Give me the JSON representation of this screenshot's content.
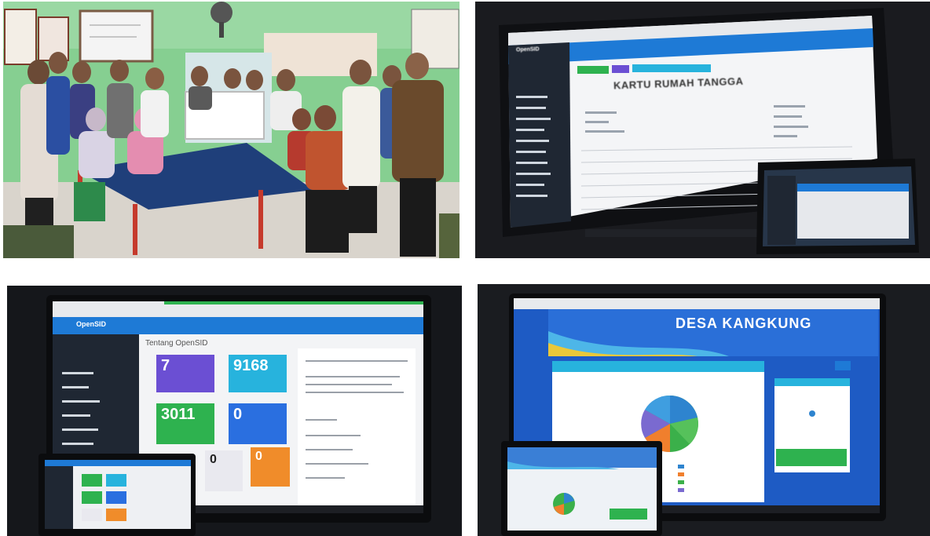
{
  "photo_top_right": {
    "app_name": "OpenSID",
    "heading": "KARTU RUMAH TANGGA"
  },
  "photo_bottom_left": {
    "app_name": "OpenSID",
    "page_title": "Tentang OpenSID",
    "tiles": [
      {
        "value": "7",
        "color": "#6b4fd3"
      },
      {
        "value": "9168",
        "color": "#27b3dd"
      },
      {
        "value": "3011",
        "color": "#2eb24f"
      },
      {
        "value": "0",
        "color": "#2a6fe0"
      },
      {
        "value": "0",
        "color": "#e9e9ef"
      },
      {
        "value": "0",
        "color": "#f08c2a"
      }
    ]
  },
  "photo_bottom_right": {
    "banner_title": "DESA KANGKUNG"
  },
  "colors": {
    "opensid_blue": "#1e7ad6",
    "sidebar_dark": "#1f2733",
    "wall_green": "#7fc98a"
  }
}
